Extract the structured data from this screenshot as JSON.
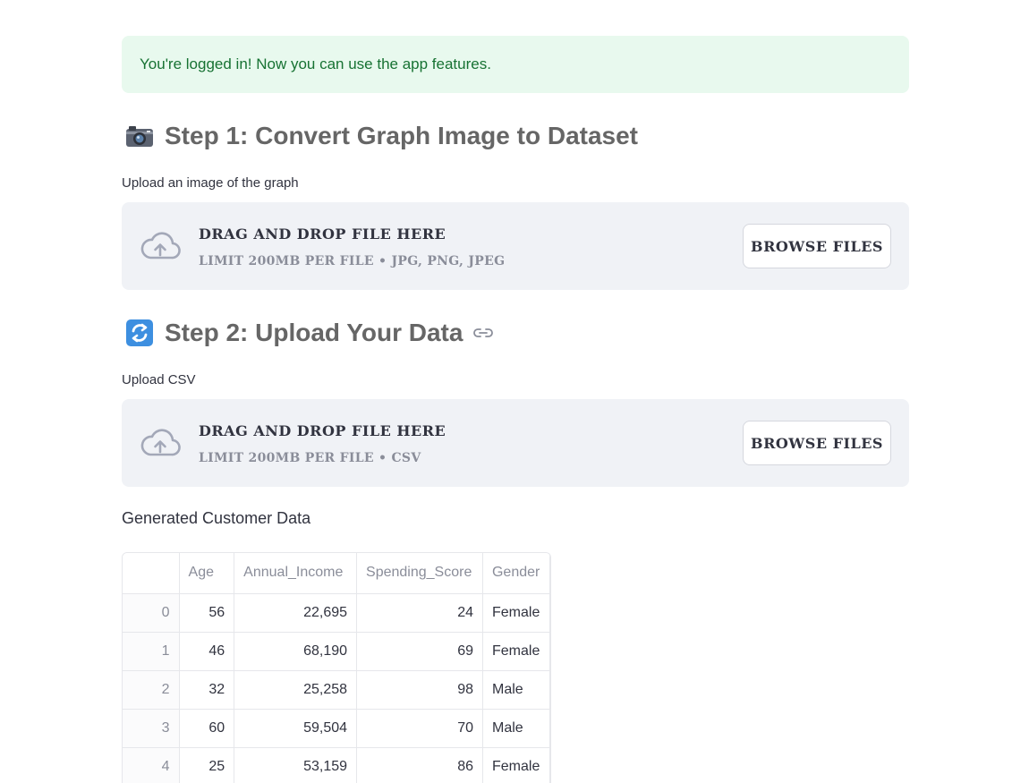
{
  "alert": {
    "text": "You're logged in! Now you can use the app features."
  },
  "step1": {
    "icon": "camera-icon",
    "title": "Step 1: Convert Graph Image to Dataset",
    "uploader_label": "Upload an image of the graph",
    "dropzone": {
      "main_text": "Drag and drop file here",
      "sub_text": "Limit 200MB per file • JPG, PNG, JPEG",
      "button": "Browse files"
    }
  },
  "step2": {
    "icon": "arrows-cycle-icon",
    "title": "Step 2: Upload Your Data",
    "uploader_label": "Upload CSV",
    "dropzone": {
      "main_text": "Drag and drop file here",
      "sub_text": "Limit 200MB per file • CSV",
      "button": "Browse files"
    }
  },
  "table": {
    "title": "Generated Customer Data",
    "columns": [
      "",
      "Age",
      "Annual_Income",
      "Spending_Score",
      "Gender"
    ],
    "rows": [
      [
        "0",
        "56",
        "22,695",
        "24",
        "Female"
      ],
      [
        "1",
        "46",
        "68,190",
        "69",
        "Female"
      ],
      [
        "2",
        "32",
        "25,258",
        "98",
        "Male"
      ],
      [
        "3",
        "60",
        "59,504",
        "70",
        "Male"
      ],
      [
        "4",
        "25",
        "53,159",
        "86",
        "Female"
      ]
    ]
  },
  "colors": {
    "alert_bg": "#e8f9ee",
    "alert_text": "#177233",
    "dropzone_bg": "#f0f2f6",
    "heading": "#666666"
  }
}
